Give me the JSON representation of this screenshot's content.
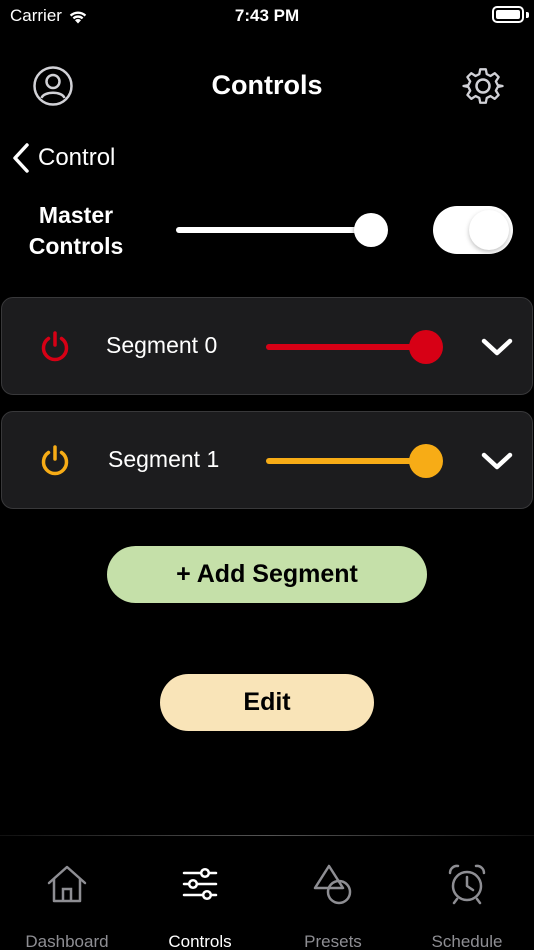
{
  "status_bar": {
    "carrier": "Carrier",
    "time": "7:43 PM"
  },
  "header": {
    "title": "Controls"
  },
  "nav": {
    "back_label": "Control"
  },
  "master": {
    "label": "Master Controls",
    "slider_value": 0.92,
    "toggle_on": true
  },
  "segments": [
    {
      "label": "Segment 0",
      "color": "#d70015",
      "slider_value": 1.0
    },
    {
      "label": "Segment 1",
      "color": "#f7ac16",
      "slider_value": 1.0
    }
  ],
  "buttons": {
    "add_segment": {
      "label": "+ Add Segment",
      "color": "#c5e0a9"
    },
    "edit": {
      "label": "Edit",
      "color": "#f9e4b8"
    }
  },
  "tabs": [
    {
      "label": "Dashboard",
      "icon": "house-icon",
      "active": false
    },
    {
      "label": "Controls",
      "icon": "sliders-icon",
      "active": true
    },
    {
      "label": "Presets",
      "icon": "shapes-icon",
      "active": false
    },
    {
      "label": "Schedule",
      "icon": "alarm-clock-icon",
      "active": false
    }
  ]
}
